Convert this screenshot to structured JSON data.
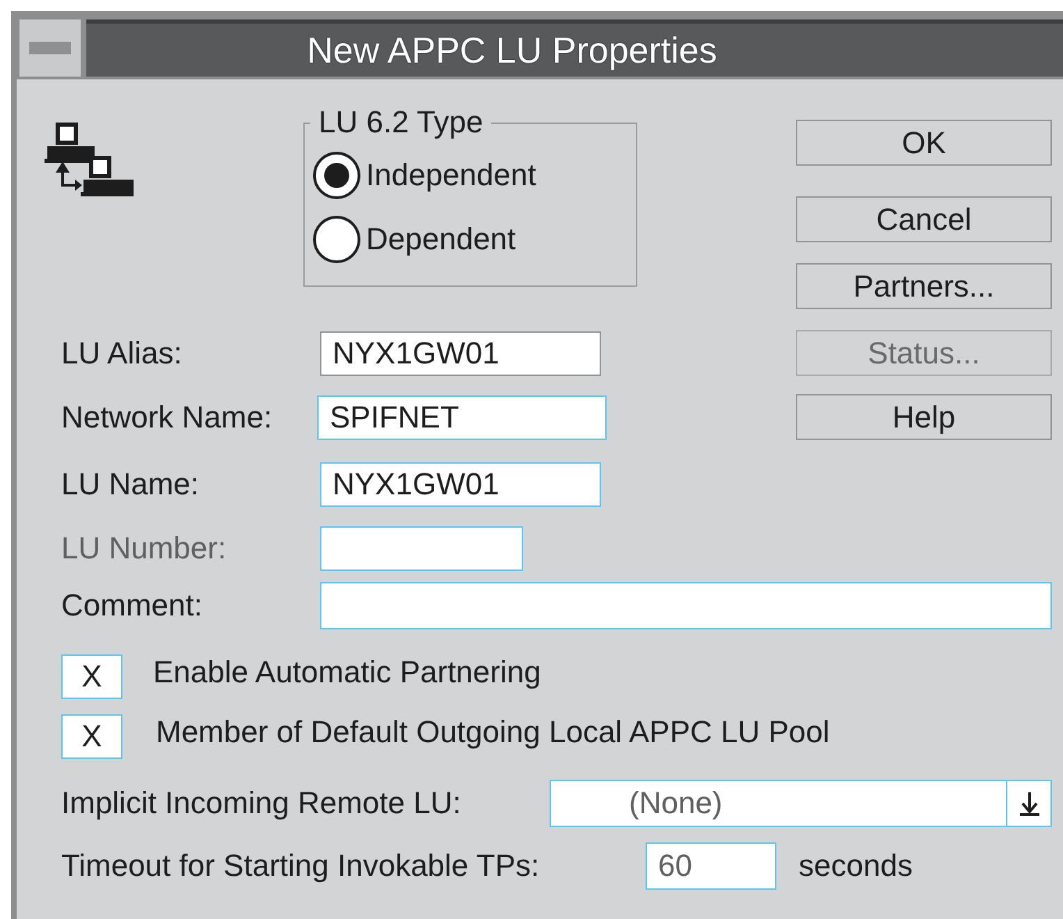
{
  "window": {
    "title": "New APPC LU Properties"
  },
  "lu_type": {
    "title": "LU 6.2 Type",
    "options": [
      {
        "label": "Independent",
        "selected": true
      },
      {
        "label": "Dependent",
        "selected": false
      }
    ]
  },
  "buttons": [
    {
      "label": "OK",
      "disabled": false
    },
    {
      "label": "Cancel",
      "disabled": false
    },
    {
      "label": "Partners...",
      "disabled": false
    },
    {
      "label": "Status...",
      "disabled": true
    },
    {
      "label": "Help",
      "disabled": false
    }
  ],
  "fields": [
    {
      "label": "LU Alias:",
      "value": "NYX1GW01",
      "disabled": false
    },
    {
      "label": "Network Name:",
      "value": "SPIFNET",
      "disabled": false
    },
    {
      "label": "LU Name:",
      "value": "NYX1GW01",
      "disabled": false
    },
    {
      "label": "LU Number:",
      "disabled": true
    }
  ],
  "comment": {
    "label": "Comment:"
  },
  "checkboxes": [
    {
      "label": "Enable Automatic Partnering",
      "checked": true,
      "mark": "X"
    },
    {
      "label": "Member of Default Outgoing Local APPC LU Pool",
      "checked": true,
      "mark": "X"
    }
  ],
  "implicit_remote_lu": {
    "label": "Implicit Incoming Remote LU:",
    "value": "(None)",
    "disabled": true
  },
  "timeout": {
    "label": "Timeout for Starting Invokable TPs:",
    "value": "60",
    "unit": "seconds",
    "disabled": true
  }
}
